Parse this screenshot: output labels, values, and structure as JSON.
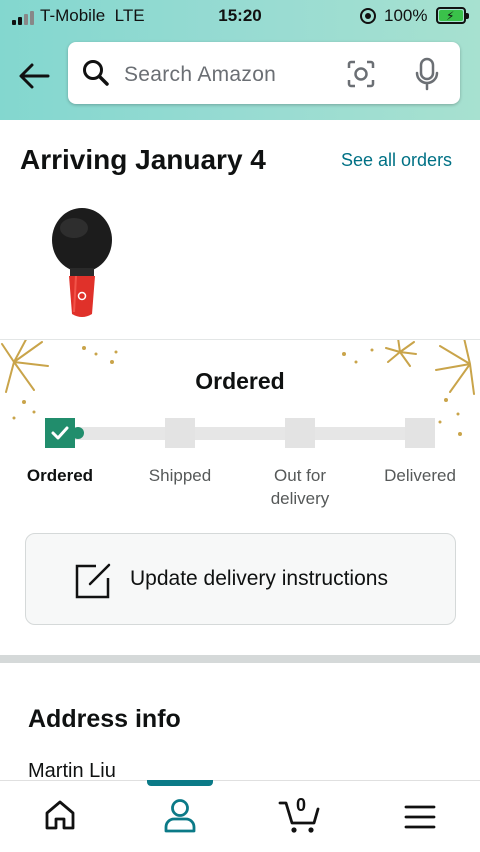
{
  "status_bar": {
    "carrier": "T-Mobile",
    "network": "LTE",
    "time": "15:20",
    "battery": "100%"
  },
  "header": {
    "search_placeholder": "Search Amazon",
    "icons": [
      "back-arrow-icon",
      "search-icon",
      "camera-scan-icon",
      "microphone-icon"
    ]
  },
  "order": {
    "arriving_title": "Arriving January 4",
    "see_all_link": "See all orders",
    "product_image": "red-black-karaoke-microphone",
    "status_title": "Ordered",
    "steps": [
      {
        "label": "Ordered",
        "done": true
      },
      {
        "label": "Shipped",
        "done": false
      },
      {
        "label": "Out for\ndelivery",
        "done": false
      },
      {
        "label": "Delivered",
        "done": false
      }
    ],
    "progress_fraction": 0.0,
    "update_button": "Update delivery instructions"
  },
  "address": {
    "title": "Address info",
    "name": "Martin Liu"
  },
  "bottom_nav": {
    "items": [
      "home-icon",
      "account-icon",
      "cart-icon",
      "menu-icon"
    ],
    "active": "account-icon",
    "cart_count": "0"
  },
  "colors": {
    "header_gradient_start": "#83d7cf",
    "header_gradient_end": "#a7e1d0",
    "link": "#007185",
    "progress_done": "#218d6c",
    "nav_active": "#0b7a87"
  }
}
